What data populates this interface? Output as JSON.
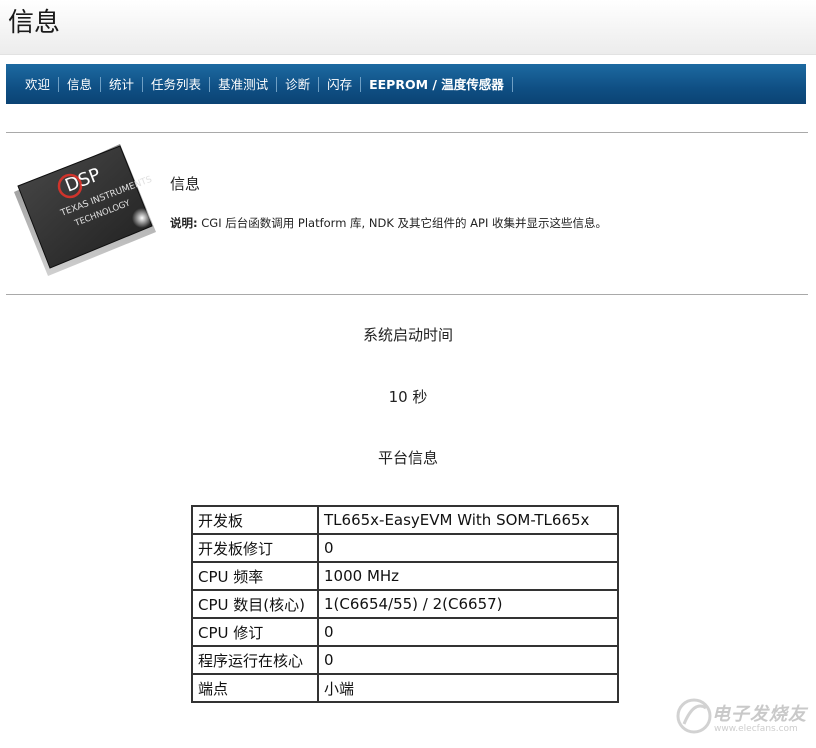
{
  "header": {
    "title": "信息"
  },
  "nav": {
    "items": [
      {
        "label": "欢迎"
      },
      {
        "label": "信息"
      },
      {
        "label": "统计"
      },
      {
        "label": "任务列表"
      },
      {
        "label": "基准测试"
      },
      {
        "label": "诊断"
      },
      {
        "label": "闪存"
      },
      {
        "label": "EEPROM / 温度传感器"
      }
    ]
  },
  "chip": {
    "logo_text": "DSP",
    "line1": "TEXAS INSTRUMENTS",
    "line2": "TECHNOLOGY"
  },
  "info": {
    "title": "信息",
    "desc_label": "说明:",
    "desc_text": " CGI 后台函数调用 Platform 库, NDK 及其它组件的 API 收集并显示这些信息。"
  },
  "uptime": {
    "label": "系统启动时间",
    "value": "10 秒"
  },
  "platform": {
    "heading": "平台信息",
    "rows": [
      {
        "key": "开发板",
        "value": "TL665x-EasyEVM With SOM-TL665x"
      },
      {
        "key": "开发板修订",
        "value": "0"
      },
      {
        "key": "CPU 频率",
        "value": "1000 MHz"
      },
      {
        "key": "CPU 数目(核心)",
        "value": "1(C6654/55) / 2(C6657)"
      },
      {
        "key": "CPU 修订",
        "value": "0"
      },
      {
        "key": "程序运行在核心",
        "value": "0"
      },
      {
        "key": "端点",
        "value": "小端"
      }
    ]
  },
  "watermark": {
    "text": "电子发烧友",
    "url": "www.elecfans.com"
  },
  "colors": {
    "nav_bg": "#0f4f84",
    "nav_text": "#ffffff"
  }
}
